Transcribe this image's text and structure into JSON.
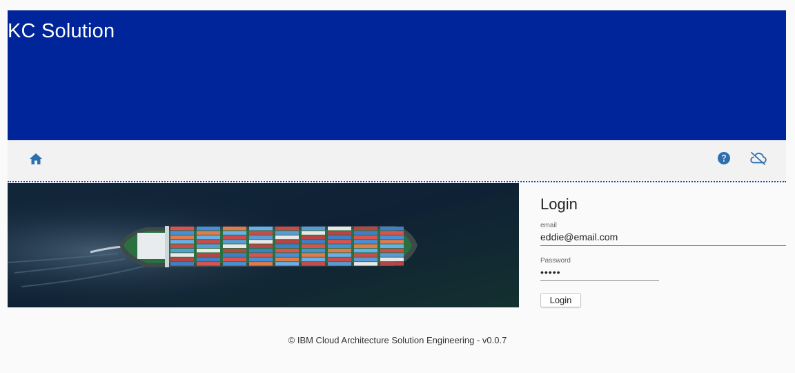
{
  "header": {
    "title": "KC Solution"
  },
  "toolbar": {
    "home_icon": "home-icon",
    "help_icon": "help-circle-icon",
    "cloud_icon": "cloud-offline-icon"
  },
  "hero": {
    "image": "container-ship-aerial-photo"
  },
  "login": {
    "title": "Login",
    "email_label": "email",
    "email_value": "eddie@email.com",
    "password_label": "Password",
    "password_value": "•••••",
    "button_label": "Login"
  },
  "footer": {
    "text": "© IBM Cloud Architecture Solution Engineering - v0.0.7"
  },
  "colors": {
    "banner": "#00259a",
    "toolbar_background": "#f2f2f2",
    "icon": "#2d6fae",
    "separator": "#1a3fd0"
  }
}
